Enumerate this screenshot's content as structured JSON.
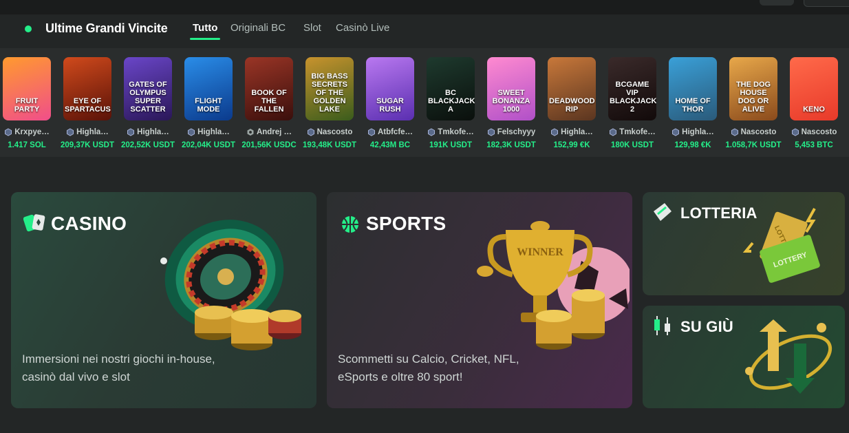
{
  "wins": {
    "title": "Ultime Grandi Vincite",
    "tabs": [
      "Tutto",
      "Originali BC",
      "Slot",
      "Casinò Live"
    ],
    "active_tab": "Tutto",
    "items": [
      {
        "game": "FRUIT PARTY",
        "user": "Krxpye…",
        "amount": "1.417 SOL",
        "badge": "hex",
        "thumb": [
          "#ff9a2e",
          "#f04e8a"
        ]
      },
      {
        "game": "EYE OF SPARTACUS",
        "user": "Highla…",
        "amount": "209,37K USDT",
        "badge": "hex",
        "thumb": [
          "#d04a1c",
          "#5a1208"
        ]
      },
      {
        "game": "GATES OF OLYMPUS SUPER SCATTER",
        "user": "Highla…",
        "amount": "202,52K USDT",
        "badge": "hex",
        "thumb": [
          "#6a46c8",
          "#2a1758"
        ]
      },
      {
        "game": "FLIGHT MODE",
        "user": "Highla…",
        "amount": "202,04K USDT",
        "badge": "hex",
        "thumb": [
          "#2a8de8",
          "#0b3a8c"
        ]
      },
      {
        "game": "BOOK OF THE FALLEN",
        "user": "Andrej …",
        "amount": "201,56K USDC",
        "badge": "ring",
        "thumb": [
          "#9a3526",
          "#3a0f0c"
        ]
      },
      {
        "game": "BIG BASS SECRETS OF THE GOLDEN LAKE",
        "user": "Nascosto",
        "amount": "193,48K USDT",
        "badge": "hex",
        "thumb": [
          "#c8932d",
          "#3a5c1c"
        ]
      },
      {
        "game": "SUGAR RUSH",
        "user": "Atbfcfe…",
        "amount": "42,43M BC",
        "badge": "hex",
        "thumb": [
          "#b978f0",
          "#5a2fb0"
        ]
      },
      {
        "game": "BC BLACKJACK A",
        "user": "Tmkofe…",
        "amount": "191K USDT",
        "badge": "hex",
        "thumb": [
          "#1e3a2e",
          "#0a0f0c"
        ]
      },
      {
        "game": "SWEET BONANZA 1000",
        "user": "Felschyyy",
        "amount": "182,3K USDT",
        "badge": "hex",
        "thumb": [
          "#ff8ad0",
          "#b050c8"
        ]
      },
      {
        "game": "DEADWOOD RIP",
        "user": "Highla…",
        "amount": "152,99 €K",
        "badge": "hex",
        "thumb": [
          "#c8783a",
          "#5a3520"
        ]
      },
      {
        "game": "BCGAME VIP BLACKJACK 2",
        "user": "Tmkofe…",
        "amount": "180K USDT",
        "badge": "hex",
        "thumb": [
          "#3a2a2a",
          "#120a0a"
        ]
      },
      {
        "game": "HOME OF THOR",
        "user": "Highla…",
        "amount": "129,98 €K",
        "badge": "hex",
        "thumb": [
          "#3aa0d8",
          "#2a5a7a"
        ]
      },
      {
        "game": "THE DOG HOUSE DOG OR ALIVE",
        "user": "Nascosto",
        "amount": "1.058,7K USDT",
        "badge": "hex",
        "thumb": [
          "#e8a84a",
          "#8a4a1c"
        ]
      },
      {
        "game": "KENO",
        "user": "Nascosto",
        "amount": "5,453 BTC",
        "badge": "hex",
        "thumb": [
          "#ff6a4a",
          "#e83a2a"
        ]
      }
    ]
  },
  "panels": {
    "casino": {
      "title": "CASINO",
      "desc": "Immersioni nei nostri giochi in-house, casinò dal vivo e slot"
    },
    "sports": {
      "title": "SPORTS",
      "desc": "Scommetti su Calcio, Cricket, NFL, eSports e oltre 80 sport!",
      "trophy_text": "WINNER"
    },
    "lottery": {
      "title": "LOTTERIA",
      "ticket_text_1": "LOTTERY",
      "ticket_text_2": "LOTTERY"
    },
    "updown": {
      "title": "SU GIÙ"
    }
  },
  "colors": {
    "accent": "#24ee89",
    "background": "#232626",
    "strip": "#2a2d2d"
  },
  "icons": [
    "live-dot-icon",
    "cards-icon",
    "basketball-icon",
    "ticket-icon",
    "candlestick-icon",
    "vip-badge-icon"
  ]
}
